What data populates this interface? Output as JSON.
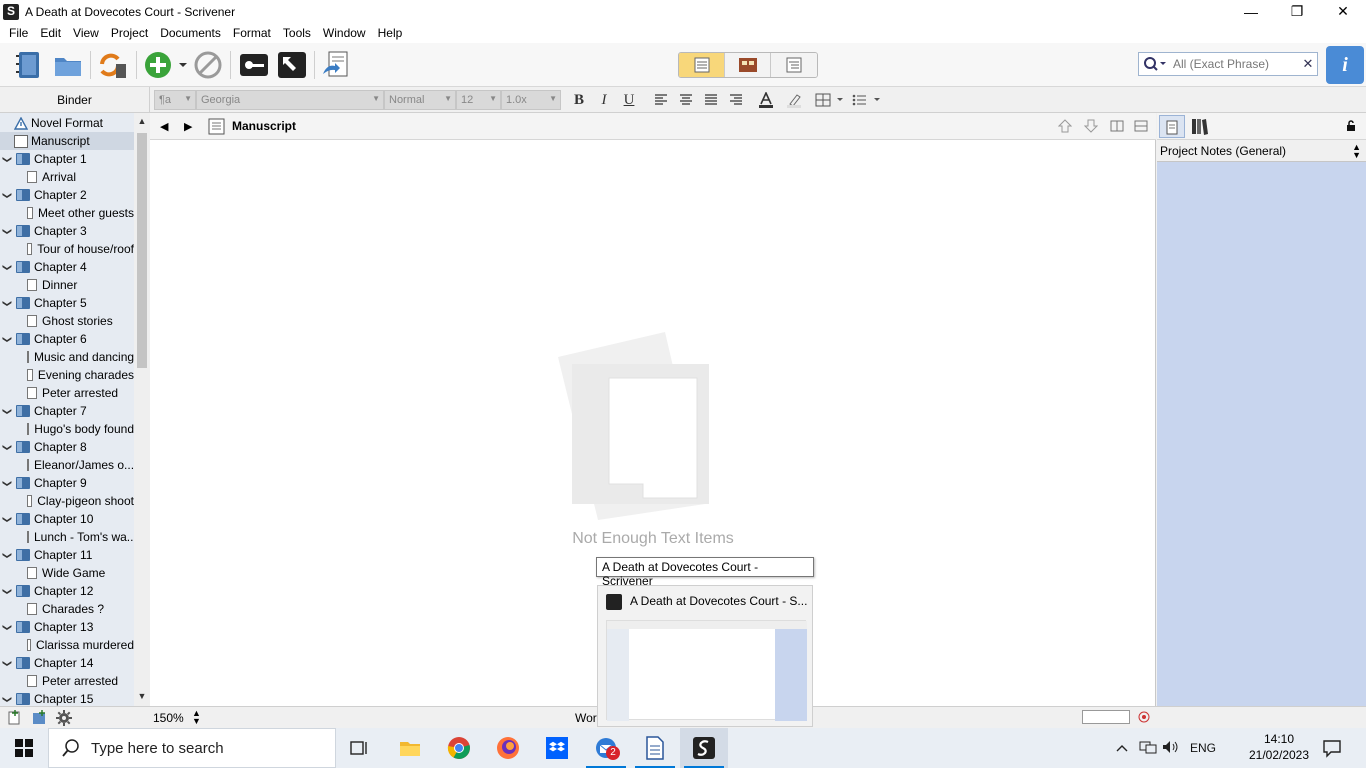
{
  "window": {
    "title": "A Death at Dovecotes Court - Scrivener",
    "minimize_glyph": "—",
    "maximize_glyph": "❐",
    "close_glyph": "✕"
  },
  "menu": [
    "File",
    "Edit",
    "View",
    "Project",
    "Documents",
    "Format",
    "Tools",
    "Window",
    "Help"
  ],
  "toolbar": {
    "search_placeholder": "All (Exact Phrase)",
    "search_clear": "✕",
    "inspector_glyph": "i",
    "accent_color": "#f8d77a"
  },
  "formatbar": {
    "binder_label": "Binder",
    "style": "¶a",
    "font": "Georgia",
    "weight": "Normal",
    "size": "12",
    "line_spacing": "1.0x",
    "bold": "B",
    "italic": "I",
    "underline": "U"
  },
  "binder": {
    "items": [
      {
        "label": "Novel Format",
        "kind": "warning"
      },
      {
        "label": "Manuscript",
        "kind": "manuscript",
        "selected": true
      },
      {
        "label": "Chapter 1",
        "kind": "folder"
      },
      {
        "label": "Arrival",
        "kind": "doc"
      },
      {
        "label": "Chapter 2",
        "kind": "folder"
      },
      {
        "label": "Meet other guests",
        "kind": "doc"
      },
      {
        "label": "Chapter 3",
        "kind": "folder"
      },
      {
        "label": "Tour of house/roof",
        "kind": "doc"
      },
      {
        "label": "Chapter 4",
        "kind": "folder"
      },
      {
        "label": "Dinner",
        "kind": "doc"
      },
      {
        "label": "Chapter 5",
        "kind": "folder"
      },
      {
        "label": "Ghost stories",
        "kind": "doc"
      },
      {
        "label": "Chapter 6",
        "kind": "folder"
      },
      {
        "label": "Music and dancing",
        "kind": "doc"
      },
      {
        "label": "Evening charades",
        "kind": "doc"
      },
      {
        "label": "Peter arrested",
        "kind": "doc"
      },
      {
        "label": "Chapter 7",
        "kind": "folder"
      },
      {
        "label": "Hugo's body found",
        "kind": "doc"
      },
      {
        "label": "Chapter 8",
        "kind": "folder"
      },
      {
        "label": "Eleanor/James o...",
        "kind": "doc"
      },
      {
        "label": "Chapter 9",
        "kind": "folder"
      },
      {
        "label": "Clay-pigeon shoot",
        "kind": "doc"
      },
      {
        "label": "Chapter 10",
        "kind": "folder"
      },
      {
        "label": "Lunch - Tom's wa...",
        "kind": "doc"
      },
      {
        "label": "Chapter 11",
        "kind": "folder"
      },
      {
        "label": "Wide Game",
        "kind": "doc"
      },
      {
        "label": "Chapter 12",
        "kind": "folder"
      },
      {
        "label": "Charades ?",
        "kind": "doc"
      },
      {
        "label": "Chapter 13",
        "kind": "folder"
      },
      {
        "label": "Clarissa murdered",
        "kind": "doc"
      },
      {
        "label": "Chapter 14",
        "kind": "folder"
      },
      {
        "label": "Peter arrested",
        "kind": "doc"
      },
      {
        "label": "Chapter 15",
        "kind": "folder"
      }
    ]
  },
  "editor": {
    "title": "Manuscript",
    "empty_message": "Not Enough Text Items"
  },
  "inspector": {
    "notes_label": "Project Notes (General)"
  },
  "status": {
    "zoom": "150%",
    "word_count_prefix": "Word"
  },
  "tooltip": {
    "text": "A Death at Dovecotes Court - Scrivener",
    "thumb_title": "A Death at Dovecotes Court - S..."
  },
  "taskbar": {
    "search_placeholder": "Type here to search",
    "language": "ENG",
    "time": "14:10",
    "date": "21/02/2023",
    "mail_badge": "2"
  }
}
